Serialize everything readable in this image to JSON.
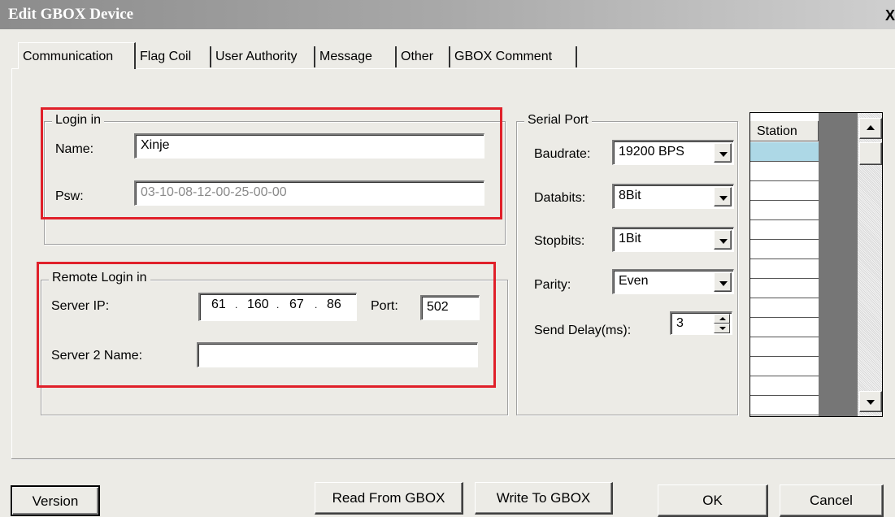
{
  "window": {
    "title": "Edit GBOX Device",
    "close_label": "X"
  },
  "tabs": [
    {
      "label": "Communication",
      "active": true
    },
    {
      "label": "Flag Coil"
    },
    {
      "label": "User Authority"
    },
    {
      "label": "Message"
    },
    {
      "label": "Other"
    },
    {
      "label": "GBOX Comment"
    }
  ],
  "login": {
    "group_title": "Login in",
    "name_label": "Name:",
    "name_value": "Xinje",
    "psw_label": "Psw:",
    "psw_value": "03-10-08-12-00-25-00-00"
  },
  "remote_login": {
    "group_title": "Remote Login in",
    "server_ip_label": "Server IP:",
    "ip_octets": [
      "61",
      "160",
      "67",
      "86"
    ],
    "ip_separator": ".",
    "port_label": "Port:",
    "port_value": "502",
    "server2_label": "Server 2 Name:",
    "server2_value": ""
  },
  "serial_port": {
    "group_title": "Serial Port",
    "baudrate_label": "Baudrate:",
    "baudrate_value": "19200 BPS",
    "databits_label": "Databits:",
    "databits_value": "8Bit",
    "stopbits_label": "Stopbits:",
    "stopbits_value": "1Bit",
    "parity_label": "Parity:",
    "parity_value": "Even",
    "send_delay_label": "Send Delay(ms):",
    "send_delay_value": "3"
  },
  "station": {
    "header": "Station",
    "selected_color": "#add8e6"
  },
  "buttons": {
    "version": "Version",
    "read": "Read From GBOX",
    "write": "Write To GBOX",
    "ok": "OK",
    "cancel": "Cancel"
  },
  "colors": {
    "highlight_red": "#e0202a",
    "dialog_bg": "#ecebe6"
  }
}
